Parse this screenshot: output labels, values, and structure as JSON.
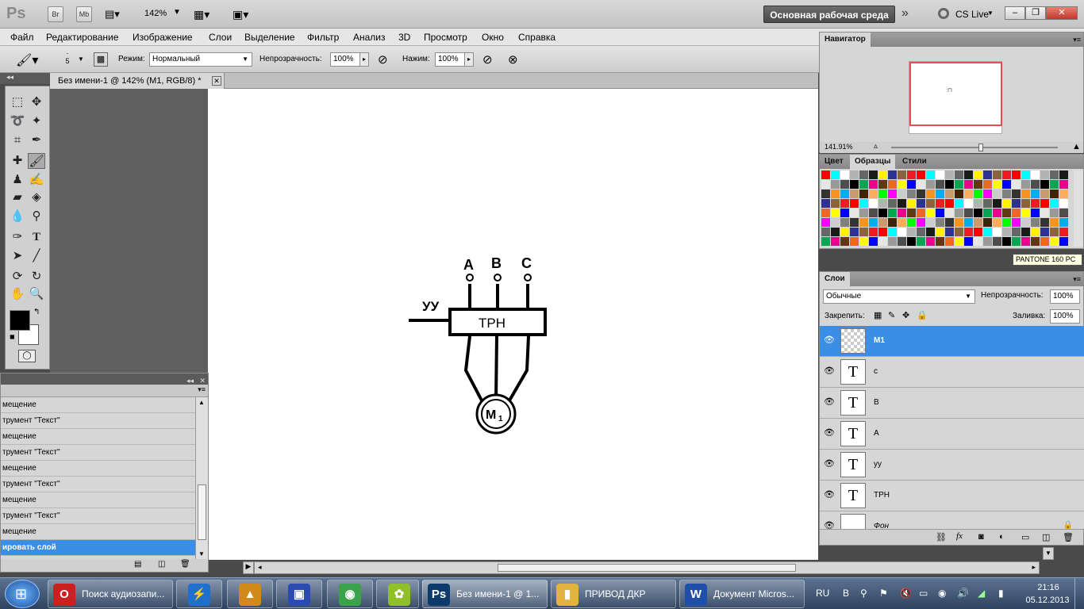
{
  "app": {
    "logo": "Ps",
    "br": "Br",
    "mb": "Mb",
    "zoom": "142%",
    "workspace": "Основная рабочая среда",
    "cslive": "CS Live"
  },
  "menu": [
    "Файл",
    "Редактирование",
    "Изображение",
    "Слои",
    "Выделение",
    "Фильтр",
    "Анализ",
    "3D",
    "Просмотр",
    "Окно",
    "Справка"
  ],
  "options": {
    "brush_size": "5",
    "mode_label": "Режим:",
    "mode_value": "Нормальный",
    "opacity_label": "Непрозрачность:",
    "opacity_value": "100%",
    "pressure_label": "Нажим:",
    "pressure_value": "100%"
  },
  "document": {
    "tab_title": "Без имени-1 @ 142% (M1, RGB/8) *"
  },
  "diagram": {
    "labels": [
      "A",
      "B",
      "C"
    ],
    "uu": "УУ",
    "trn": "ТРН",
    "motor": "М",
    "motor_sub": "1"
  },
  "navigator": {
    "title": "Навигатор",
    "zoom": "141.91%"
  },
  "swatches": {
    "tabs": [
      "Цвет",
      "Образцы",
      "Стили"
    ],
    "tooltip": "PANTONE 160 PC",
    "colors": [
      "#ff0000",
      "#ffff00",
      "#00ff00",
      "#00ffff",
      "#0000ff",
      "#ff00ff",
      "#ffffff",
      "#e6e6e6",
      "#cccccc",
      "#b3b3b3",
      "#999999",
      "#808080",
      "#666666",
      "#4d4d4d",
      "#333333",
      "#1a1a1a",
      "#000000",
      "#f7941d",
      "#fff200",
      "#00a651",
      "#00aeef",
      "#2e3192",
      "#ec008c",
      "#c69c6d",
      "#8c6239",
      "#603913",
      "#42210b",
      "#ed1c24",
      "#f26522",
      "#fbaf5d"
    ]
  },
  "layers": {
    "title": "Слои",
    "blend": "Обычные",
    "opacity_label": "Непрозрачность:",
    "opacity_value": "100%",
    "lock_label": "Закрепить:",
    "fill_label": "Заливка:",
    "fill_value": "100%",
    "items": [
      {
        "name": "M1",
        "thumb": ""
      },
      {
        "name": "c",
        "thumb": "T"
      },
      {
        "name": "B",
        "thumb": "T"
      },
      {
        "name": "A",
        "thumb": "T"
      },
      {
        "name": "уу",
        "thumb": "T"
      },
      {
        "name": "ТРН",
        "thumb": "T"
      },
      {
        "name": "Фон",
        "thumb": ""
      }
    ]
  },
  "history": {
    "items": [
      "мещение",
      "трумент \"Текст\"",
      "мещение",
      "трумент \"Текст\"",
      "мещение",
      "трумент \"Текст\"",
      "мещение",
      "трумент \"Текст\"",
      "мещение",
      "ировать слой"
    ]
  },
  "taskbar": {
    "items": [
      {
        "label": "Поиск аудиозапи...",
        "color": "#cc1f1f",
        "glyph": "O"
      },
      {
        "label": "",
        "color": "#1f6fcc",
        "glyph": "⚡"
      },
      {
        "label": "",
        "color": "#d08a1a",
        "glyph": "▲"
      },
      {
        "label": "",
        "color": "#2a4bb0",
        "glyph": "▣"
      },
      {
        "label": "",
        "color": "#3aa34a",
        "glyph": "◉"
      },
      {
        "label": "",
        "color": "#8fbf2a",
        "glyph": "✿"
      },
      {
        "label": "Без имени-1 @ 1...",
        "color": "#0b3a6b",
        "glyph": "Ps"
      },
      {
        "label": "ПРИВОД ДКР",
        "color": "#e3b340",
        "glyph": "▮"
      },
      {
        "label": "Документ Micros...",
        "color": "#1f4fa8",
        "glyph": "W"
      }
    ],
    "lang": "RU",
    "time": "21:16",
    "date": "05.12.2013"
  }
}
